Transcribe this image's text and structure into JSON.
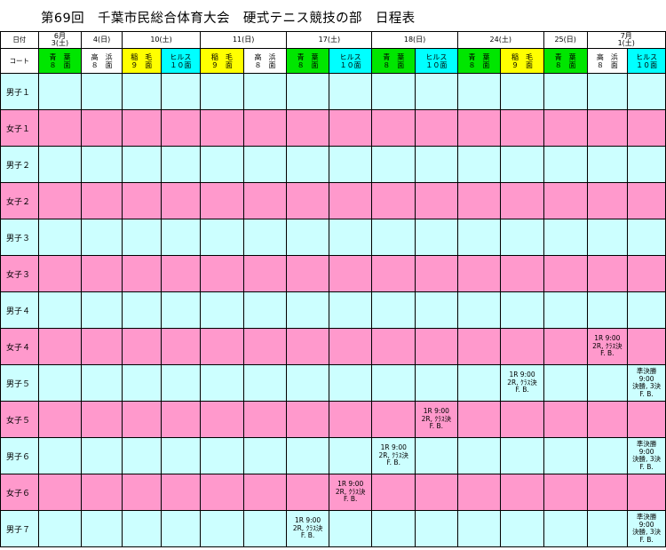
{
  "title": "第69回　千葉市民総合体育大会　硬式テニス競技の部　日程表",
  "header": {
    "date_label": "日付",
    "court_label": "コート",
    "dates": [
      {
        "text": "6月\n3(土)",
        "span": 1
      },
      {
        "text": "4(日)",
        "span": 1
      },
      {
        "text": "10(土)",
        "span": 2
      },
      {
        "text": "11(日)",
        "span": 2
      },
      {
        "text": "17(土)",
        "span": 2
      },
      {
        "text": "18(日)",
        "span": 2
      },
      {
        "text": "24(土)",
        "span": 2
      },
      {
        "text": "25(日)",
        "span": 1
      },
      {
        "text": "7月\n1(土)",
        "span": 2
      }
    ],
    "courts": [
      {
        "name": "青　葉\n８　面",
        "color": "green"
      },
      {
        "name": "高　浜\n８　面",
        "color": "white"
      },
      {
        "name": "稲　毛\n９　面",
        "color": "yellow"
      },
      {
        "name": "ヒルス\n１０面",
        "color": "cyan"
      },
      {
        "name": "稲　毛\n９　面",
        "color": "yellow"
      },
      {
        "name": "高　浜\n８　面",
        "color": "white"
      },
      {
        "name": "青　葉\n８　面",
        "color": "green"
      },
      {
        "name": "ヒルス\n１０面",
        "color": "cyan"
      },
      {
        "name": "青　葉\n８　面",
        "color": "green"
      },
      {
        "name": "ヒルス\n１０面",
        "color": "cyan"
      },
      {
        "name": "青　葉\n８　面",
        "color": "green"
      },
      {
        "name": "稲　毛\n９　面",
        "color": "yellow"
      },
      {
        "name": "青　葉\n８　面",
        "color": "green"
      },
      {
        "name": "高　浜\n８　面",
        "color": "white"
      },
      {
        "name": "ヒルス\n１０面",
        "color": "cyan"
      }
    ]
  },
  "rows": [
    {
      "label": "男子１",
      "gender": "boy",
      "entries": []
    },
    {
      "label": "女子１",
      "gender": "girl",
      "entries": []
    },
    {
      "label": "男子２",
      "gender": "boy",
      "entries": []
    },
    {
      "label": "女子２",
      "gender": "girl",
      "entries": []
    },
    {
      "label": "男子３",
      "gender": "boy",
      "entries": []
    },
    {
      "label": "女子３",
      "gender": "girl",
      "entries": []
    },
    {
      "label": "男子４",
      "gender": "boy",
      "entries": []
    },
    {
      "label": "女子４",
      "gender": "girl",
      "entries": [
        {
          "col": 13,
          "text": "1R 9:00\n2R, ｸﾗｽ決\nF. B."
        }
      ]
    },
    {
      "label": "男子５",
      "gender": "boy",
      "entries": [
        {
          "col": 11,
          "text": "1R 9:00\n2R, ｸﾗｽ決\nF. B."
        },
        {
          "col": 14,
          "text": "準決勝\n9:00\n決勝, 3決\nF. B."
        }
      ]
    },
    {
      "label": "女子５",
      "gender": "girl",
      "entries": [
        {
          "col": 9,
          "text": "1R 9:00\n2R, ｸﾗｽ決\nF. B."
        }
      ]
    },
    {
      "label": "男子６",
      "gender": "boy",
      "entries": [
        {
          "col": 8,
          "text": "1R 9:00\n2R, ｸﾗｽ決\nF. B."
        },
        {
          "col": 14,
          "text": "準決勝\n9:00\n決勝, 3決\nF. B."
        }
      ]
    },
    {
      "label": "女子６",
      "gender": "girl",
      "entries": [
        {
          "col": 7,
          "text": "1R 9:00\n2R, ｸﾗｽ決\nF. B."
        }
      ]
    },
    {
      "label": "男子７",
      "gender": "boy",
      "entries": [
        {
          "col": 6,
          "text": "1R 9:00\n2R, ｸﾗｽ決\nF. B."
        },
        {
          "col": 14,
          "text": "準決勝\n9:00\n決勝, 3決\nF. B."
        }
      ]
    }
  ]
}
